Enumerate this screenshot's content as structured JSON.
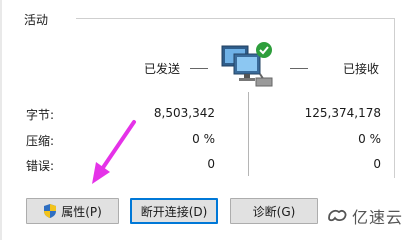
{
  "group": {
    "title": "活动"
  },
  "columns": {
    "sent": "已发送",
    "received": "已接收"
  },
  "rows": [
    {
      "label": "字节:",
      "sent": "8,503,342",
      "received": "125,374,178"
    },
    {
      "label": "压缩:",
      "sent": "0 %",
      "received": "0 %"
    },
    {
      "label": "错误:",
      "sent": "0",
      "received": "0"
    }
  ],
  "buttons": {
    "properties": "属性(P)",
    "disconnect": "断开连接(D)",
    "diagnose": "诊断(G)"
  },
  "watermark": {
    "text": "亿速云"
  },
  "colors": {
    "arrow": "#e532e8",
    "focus_border": "#0078d7",
    "check": "#2e9e3c"
  },
  "icons": [
    "network-computer-icon",
    "shield-icon",
    "logo-icon"
  ]
}
